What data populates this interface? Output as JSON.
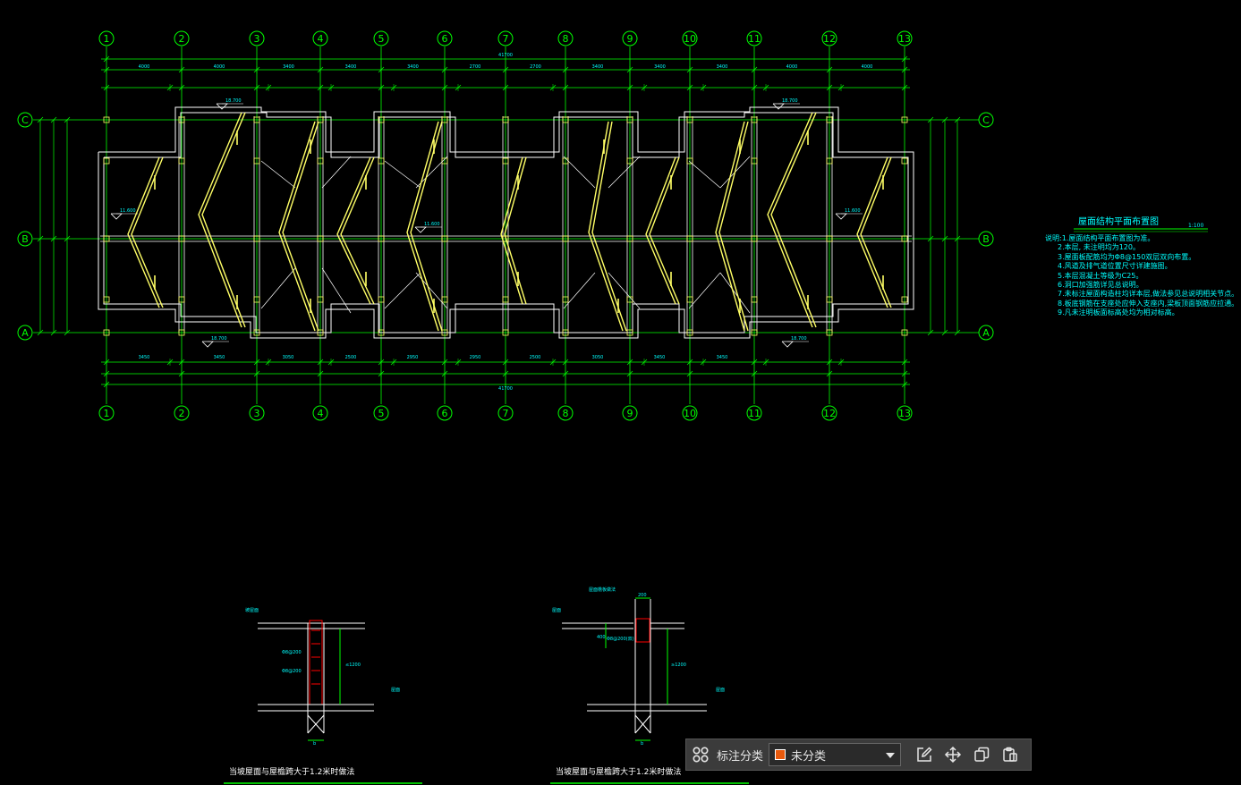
{
  "colors": {
    "background": "#000000",
    "axis": "#00ff00",
    "wall": "#ffffff",
    "rebar": "#ffff66",
    "text": "#00ffff",
    "section_red": "#ff0000",
    "toolbar_bg": "#3b3b3b",
    "tag_swatch": "#e8590c"
  },
  "grid": {
    "column_labels": [
      "1",
      "2",
      "3",
      "4",
      "5",
      "6",
      "7",
      "8",
      "9",
      "10",
      "11",
      "12",
      "13"
    ],
    "row_labels": [
      "C",
      "B",
      "A"
    ]
  },
  "plan": {
    "title": "屋面结构平面布置图",
    "scale": "1:100",
    "overall_dim_top": "41700",
    "overall_dim_bottom": "41700",
    "elevation_marks": [
      "18.700",
      "18.700",
      "18.700",
      "18.700",
      "11.600",
      "11.600",
      "11.600"
    ],
    "top_dims": [
      "4000",
      "4000",
      "3400",
      "3400",
      "3400",
      "2700",
      "2700",
      "3400",
      "3400",
      "3400",
      "4000",
      "4000"
    ],
    "bottom_dims": [
      "3450",
      "3450",
      "3050",
      "2500",
      "2950",
      "2950",
      "2500",
      "3050",
      "3450",
      "3450"
    ]
  },
  "notes": {
    "heading": "说明:1.屋面结构平面布置图为准。",
    "items": [
      "2.本层, 未注明均为120。",
      "3.屋面板配筋均为Φ8@150双层双向布置。",
      "4.风道及排气道位置尺寸详建施图。",
      "5.本层混凝土等级为C25。",
      "6.洞口加强筋详见总说明。",
      "7.未标注屋面构造柱均详本层,做法参见总说明相关节点。",
      "8.板底钢筋在支座处应伸入支座内,梁板顶面钢筋应拉通。",
      "9.凡未注明板面标高处均为相对标高。"
    ]
  },
  "details": [
    {
      "caption": "当坡屋面与屋檐跨大于1.2米时做法",
      "labels": [
        "坡屋面",
        "Φ8@200",
        "Φ8@200",
        "屋面",
        "≤1200",
        "b"
      ]
    },
    {
      "caption": "当坡屋面与屋檐跨大于1.2米时做法",
      "labels": [
        "屋面檐板做法",
        "200",
        "屋面",
        "400",
        "Φ8@200(双)",
        "≥1200",
        "屋面",
        "b"
      ]
    }
  ],
  "toolbar": {
    "grid_icon": "grid-icon",
    "label": "标注分类",
    "select_value": "未分类",
    "edit_icon": "edit-icon",
    "move_icon": "move-icon",
    "copy_icon": "copy-icon",
    "paste_icon": "paste-icon"
  }
}
